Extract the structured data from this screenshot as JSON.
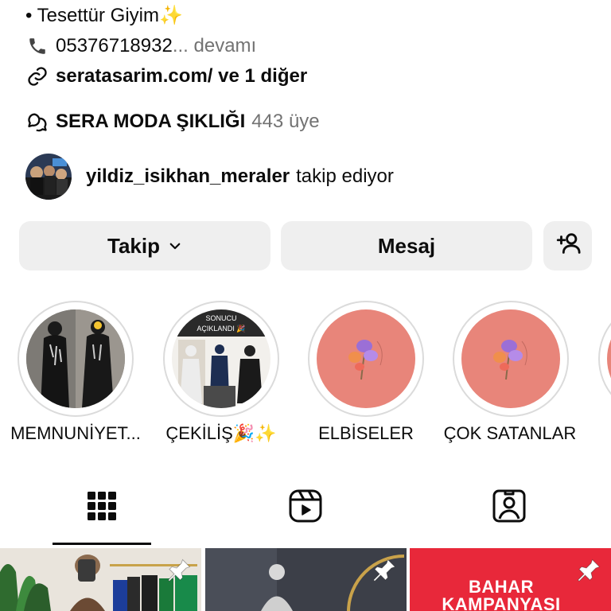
{
  "bio": {
    "category_line": "• Tesettür Giyim✨",
    "phone": "05376718932",
    "more": "... devamı",
    "link": "seratasarim.com/ ve 1 diğer"
  },
  "channel": {
    "name": "SERA MODA ŞIKLIĞI",
    "members": "443 üye"
  },
  "followed_by": {
    "username": "yildiz_isikhan_meraler",
    "suffix": "takip ediyor"
  },
  "actions": {
    "follow_label": "Takip",
    "message_label": "Mesaj"
  },
  "highlights": [
    {
      "label": "MEMNUNİYET..."
    },
    {
      "label": "ÇEKİLİŞ🎉✨"
    },
    {
      "label": "ELBİSELER"
    },
    {
      "label": "ÇOK SATANLAR"
    }
  ],
  "highlight_2_caption": "SONUCU AÇIKLANDI 🎉",
  "posts": {
    "third_text": "BAHAR KAMPANYASI"
  },
  "colors": {
    "button_bg": "#efefef",
    "highlight_pink": "#e8857a",
    "promo_red": "#e8283a"
  }
}
